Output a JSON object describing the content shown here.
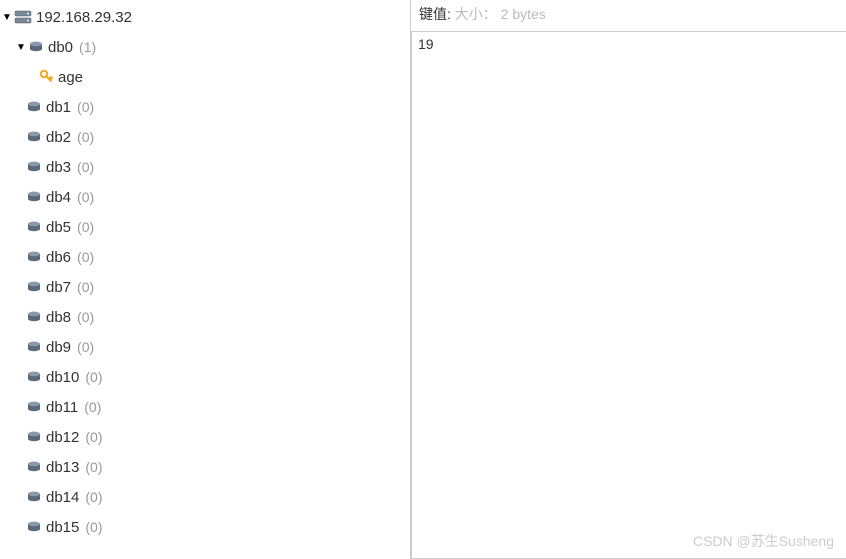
{
  "server": {
    "host": "192.168.29.32"
  },
  "tree": {
    "db0": {
      "name": "db0",
      "count": "(1)"
    },
    "key_age": "age",
    "others": [
      {
        "name": "db1",
        "count": "(0)"
      },
      {
        "name": "db2",
        "count": "(0)"
      },
      {
        "name": "db3",
        "count": "(0)"
      },
      {
        "name": "db4",
        "count": "(0)"
      },
      {
        "name": "db5",
        "count": "(0)"
      },
      {
        "name": "db6",
        "count": "(0)"
      },
      {
        "name": "db7",
        "count": "(0)"
      },
      {
        "name": "db8",
        "count": "(0)"
      },
      {
        "name": "db9",
        "count": "(0)"
      },
      {
        "name": "db10",
        "count": "(0)"
      },
      {
        "name": "db11",
        "count": "(0)"
      },
      {
        "name": "db12",
        "count": "(0)"
      },
      {
        "name": "db13",
        "count": "(0)"
      },
      {
        "name": "db14",
        "count": "(0)"
      },
      {
        "name": "db15",
        "count": "(0)"
      }
    ]
  },
  "detail": {
    "label_keyvalue": "键值:",
    "label_size": "大小：",
    "size_value": "2 bytes",
    "value": "19"
  },
  "watermark": "CSDN @苏生Susheng"
}
